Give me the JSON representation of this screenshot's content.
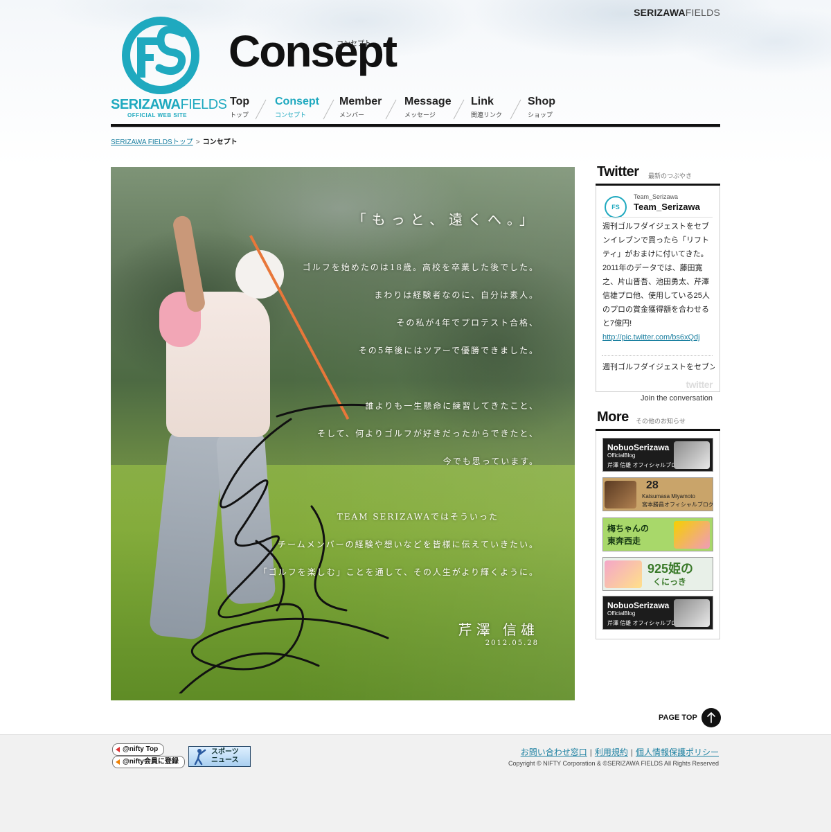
{
  "header": {
    "brand_top_bold": "SERIZAWA",
    "brand_top_light": "FIELDS",
    "logo_name_bold": "SERIZAWA",
    "logo_name_thin": "FIELDS",
    "logo_sub": "OFFICIAL WEB SITE",
    "page_title": "Consept",
    "page_title_kana": "コンセプト"
  },
  "nav": {
    "items": [
      {
        "en": "Top",
        "ja": "トップ",
        "active": false
      },
      {
        "en": "Consept",
        "ja": "コンセプト",
        "active": true
      },
      {
        "en": "Member",
        "ja": "メンバー",
        "active": false
      },
      {
        "en": "Message",
        "ja": "メッセージ",
        "active": false
      },
      {
        "en": "Link",
        "ja": "関連リンク",
        "active": false
      },
      {
        "en": "Shop",
        "ja": "ショップ",
        "active": false
      }
    ]
  },
  "breadcrumb": {
    "home": "SERIZAWA FIELDSトップ",
    "separator": ">",
    "current": "コンセプト"
  },
  "hero": {
    "headline": "「もっと、遠くへ。」",
    "lines": [
      "ゴルフを始めたのは18歳。高校を卒業した後でした。",
      "まわりは経験者なのに、自分は素人。",
      "その私が4年でプロテスト合格、",
      "その5年後にはツアーで優勝できました。",
      "誰よりも一生懸命に練習してきたこと、",
      "そして、何よりゴルフが好きだったからできたと、",
      "今でも思っています。",
      "TEAM SERIZAWAではそういった",
      "チームメンバーの経験や想いなどを皆様に伝えていきたい。",
      "「ゴルフを楽しむ」ことを通して、その人生がより輝くように。"
    ],
    "name": "芹澤 信雄",
    "date": "2012.05.28"
  },
  "twitter": {
    "title": "Twitter",
    "subtitle": "最新のつぶやき",
    "handle_small": "Team_Serizawa",
    "handle": "Team_Serizawa",
    "tweet1": "週刊ゴルフダイジェストをセブンイレブンで買ったら「リフトティ」がおまけに付いてきた。2011年のデータでは、藤田寛之、片山晋吾、池田勇太、芹澤信雄プロ他、使用している25人のプロの賞金獲得額を合わせると7億円!",
    "tweet1_link": "http://pic.twitter.com/bs6xQdj",
    "tweet2": "週刊ゴルフダイジェストをセブン",
    "logo_text": "twitter",
    "join": "Join the conversation"
  },
  "more": {
    "title": "More",
    "subtitle": "その他のお知らせ",
    "banners": [
      {
        "title": "NobuoSerizawa",
        "sub": "OfficialBlog",
        "jp": "芹澤 信雄 オフィシャルブログ",
        "bg": "#1c1c1c",
        "fg": "#ffffff"
      },
      {
        "title": "28",
        "sub": "Katsumasa Miyamoto",
        "jp": "宮本勝昌オフィシャルブログ",
        "bg": "#c9a46a",
        "fg": "#222222"
      },
      {
        "title": "梅ちゃんの",
        "sub": "東奔西走",
        "jp": "",
        "bg": "#a8d86a",
        "fg": "#113311"
      },
      {
        "title": "925姫の",
        "sub": "くにっき",
        "jp": "",
        "bg": "#e8f0e8",
        "fg": "#3a7a2a"
      },
      {
        "title": "NobuoSerizawa",
        "sub": "OfficialBlog",
        "jp": "芹澤 信雄 オフィシャルブログ",
        "bg": "#1c1c1c",
        "fg": "#ffffff"
      }
    ]
  },
  "pagetop": {
    "label": "PAGE TOP"
  },
  "footer": {
    "nifty_top": "@nifty Top",
    "nifty_join": "@nifty会員に登録",
    "sports_line1": "スポーツ",
    "sports_line2": "ニュース",
    "links": [
      "お問い合わせ窓口",
      "利用規約",
      "個人情報保護ポリシー"
    ],
    "copyright": "Copyright © NIFTY Corporation & ©SERIZAWA FIELDS  All Rights Reserved"
  },
  "colors": {
    "accent": "#1fa9bf",
    "link": "#1a7fa0",
    "rule": "#111111"
  }
}
